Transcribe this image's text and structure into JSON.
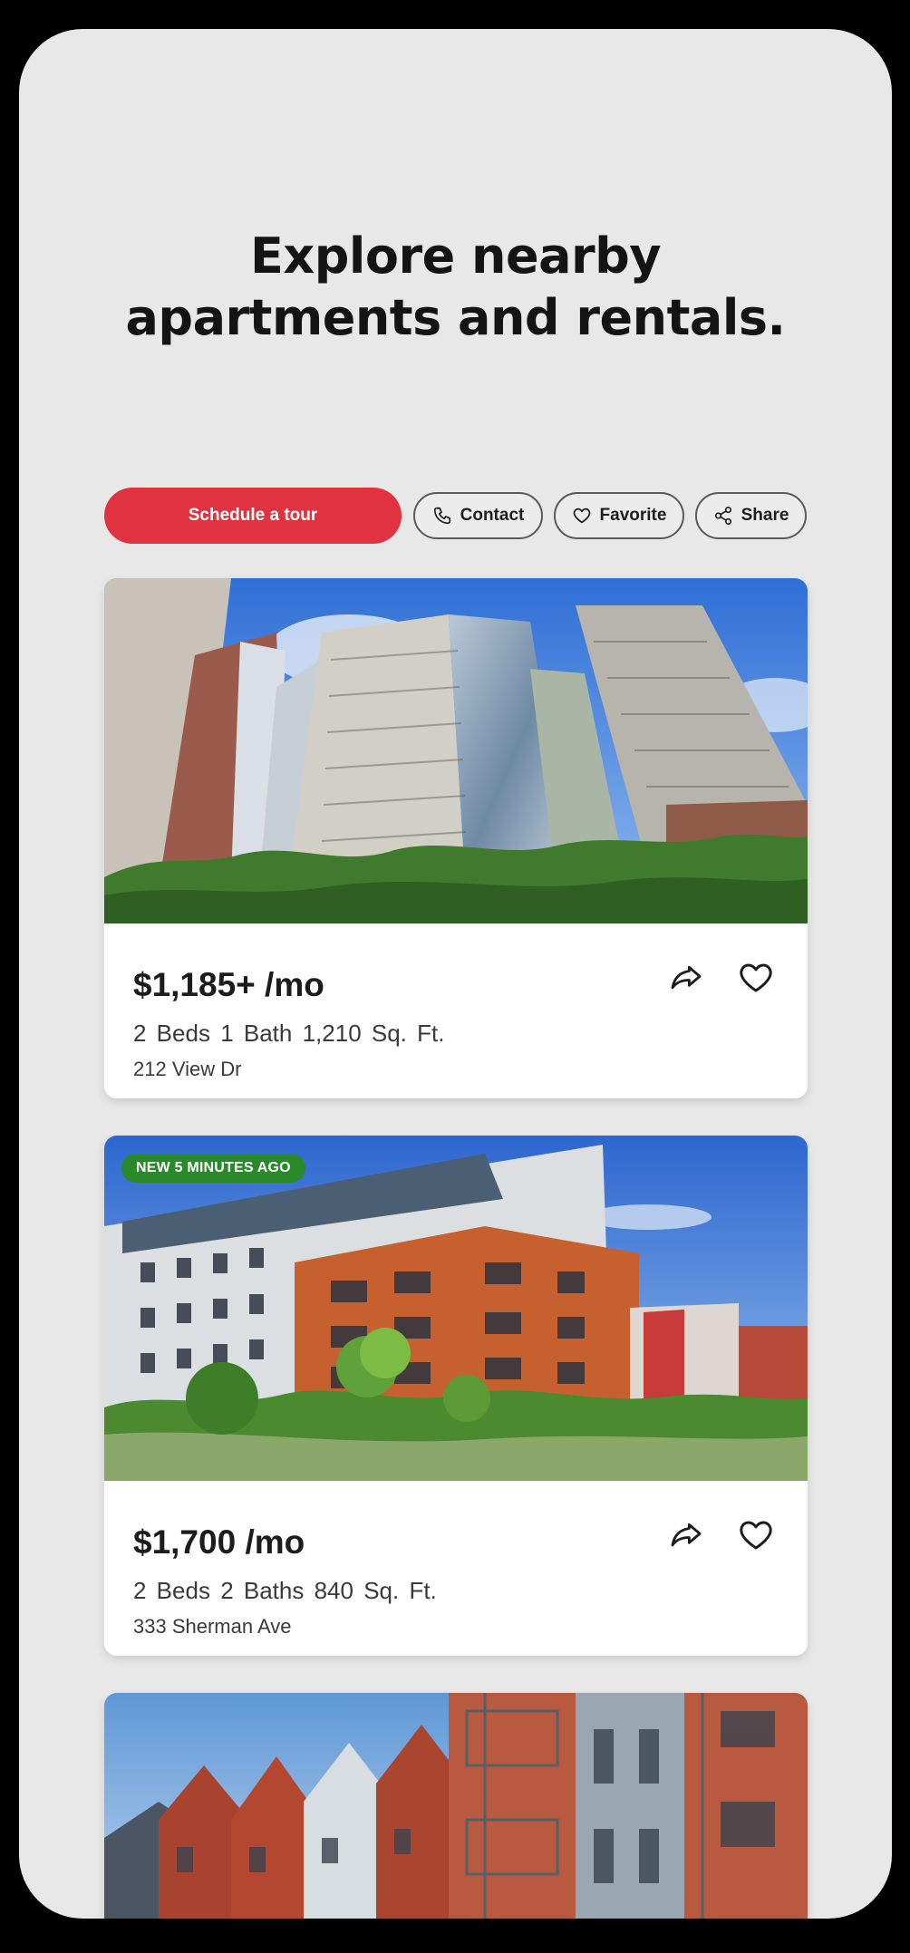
{
  "headline": {
    "line1": "Explore nearby",
    "line2": "apartments and rentals."
  },
  "actions": {
    "schedule_label": "Schedule a tour",
    "contact_label": "Contact",
    "favorite_label": "Favorite",
    "share_label": "Share"
  },
  "listings": [
    {
      "price": "$1,185+ /mo",
      "beds": "2 Beds",
      "baths": "1 Bath",
      "sqft": "1,210 Sq. Ft.",
      "address": "212 View Dr",
      "badge": ""
    },
    {
      "price": "$1,700 /mo",
      "beds": "2 Beds",
      "baths": "2 Baths",
      "sqft": "840 Sq. Ft.",
      "address": "333 Sherman Ave",
      "badge": "NEW 5 MINUTES AGO"
    }
  ],
  "icons": {
    "contact": "phone-icon",
    "favorite": "heart-icon",
    "share": "share-nodes-icon",
    "card_share": "forward-arrow-icon",
    "card_favorite": "heart-outline-icon"
  },
  "colors": {
    "accent": "#e0323f",
    "badge_green": "#2a8a2a",
    "background": "#e8e8e8"
  }
}
